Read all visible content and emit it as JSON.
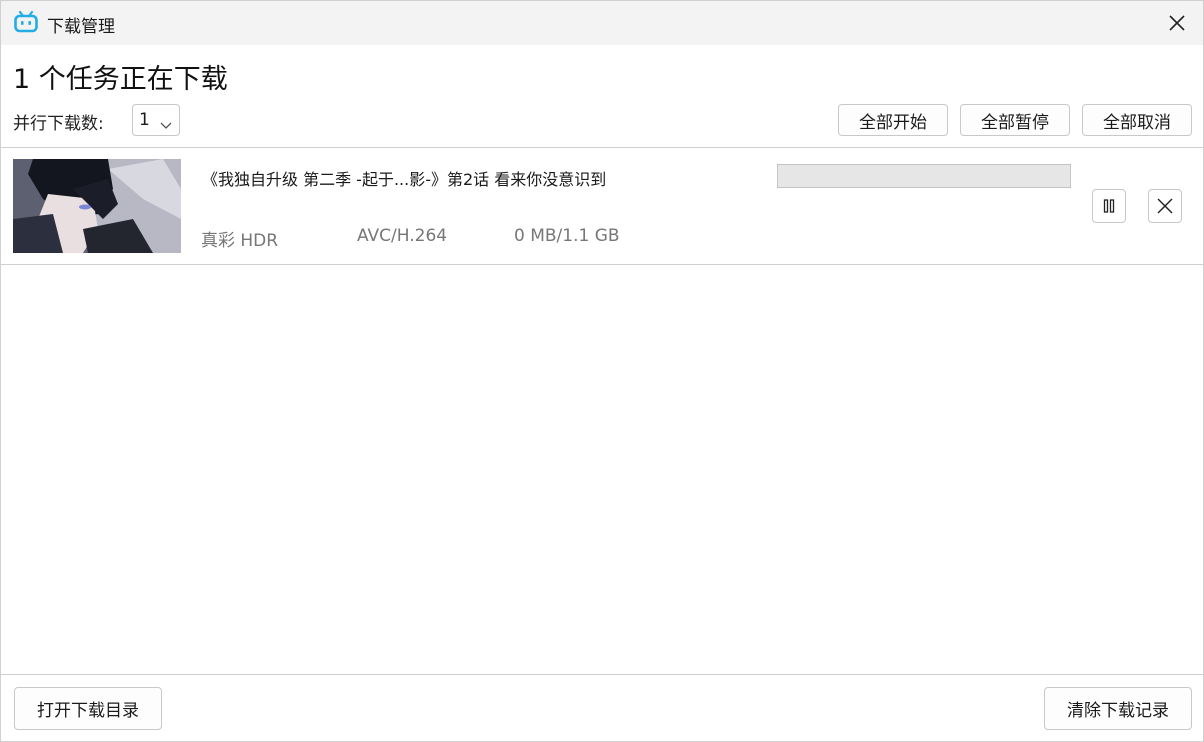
{
  "window": {
    "title": "下载管理"
  },
  "header": {
    "heading": "1 个任务正在下载",
    "parallel_label": "并行下载数:",
    "parallel_value": "1",
    "start_all": "全部开始",
    "pause_all": "全部暂停",
    "cancel_all": "全部取消"
  },
  "downloads": [
    {
      "title": "《我独自升级 第二季 -起于...影-》第2话 看来你没意识到",
      "quality": "真彩 HDR",
      "codec": "AVC/H.264",
      "size": "0 MB/1.1 GB",
      "progress": 0
    }
  ],
  "footer": {
    "open_folder": "打开下载目录",
    "clear_history": "清除下载记录"
  },
  "colors": {
    "accent": "#23ade5",
    "titlebar_bg": "#f3f3f3",
    "progress_track": "#e6e6e6"
  }
}
